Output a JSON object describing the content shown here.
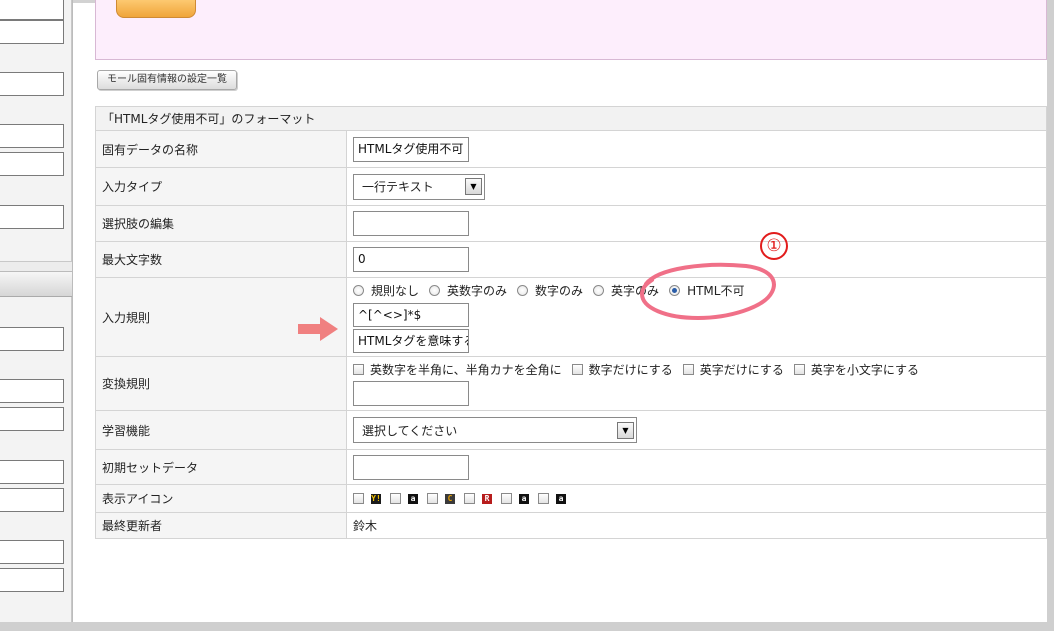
{
  "mall_button_label": "モール固有情報の設定一覧",
  "form_title": "「HTMLタグ使用不可」のフォーマット",
  "rows": {
    "name": {
      "label": "固有データの名称",
      "value": "HTMLタグ使用不可"
    },
    "input_type": {
      "label": "入力タイプ",
      "value": "一行テキスト"
    },
    "choices": {
      "label": "選択肢の編集",
      "value": ""
    },
    "max_chars": {
      "label": "最大文字数",
      "value": "0"
    },
    "input_rule": {
      "label": "入力規則",
      "options": [
        "規則なし",
        "英数字のみ",
        "数字のみ",
        "英字のみ",
        "HTML不可"
      ],
      "selected": "HTML不可",
      "regex": "^[^<>]*$",
      "message": "HTMLタグを意味する!"
    },
    "convert_rule": {
      "label": "変換規則",
      "options": [
        "英数字を半角に、半角カナを全角に",
        "数字だけにする",
        "英字だけにする",
        "英字を小文字にする"
      ],
      "value": ""
    },
    "learning": {
      "label": "学習機能",
      "value": "選択してください"
    },
    "initial_data": {
      "label": "初期セットデータ",
      "value": ""
    },
    "display_icon": {
      "label": "表示アイコン",
      "icons": [
        {
          "char": "Y!",
          "bg": "#1a1a1a",
          "fg": "#f5c400",
          "name": "yahoo-icon"
        },
        {
          "char": "a",
          "bg": "#111111",
          "fg": "#ffffff",
          "name": "amazon-icon"
        },
        {
          "char": "C",
          "bg": "#3a3a3a",
          "fg": "#e8a000",
          "name": "c-icon"
        },
        {
          "char": "R",
          "bg": "#b71c1c",
          "fg": "#ffffff",
          "name": "rakuten-icon"
        },
        {
          "char": "a",
          "bg": "#111111",
          "fg": "#ffffff",
          "name": "amazon-icon-2"
        },
        {
          "char": "a",
          "bg": "#111111",
          "fg": "#ffffff",
          "name": "amazon-icon-3"
        }
      ]
    },
    "last_updated_by": {
      "label": "最終更新者",
      "value": "鈴木"
    }
  },
  "annotation": {
    "number": "①"
  },
  "colors": {
    "annotation_red": "#e21c1c",
    "highlight_pink": "#f07088",
    "arrow_pink": "#f08080",
    "banner_pink": "#fdeefc"
  }
}
